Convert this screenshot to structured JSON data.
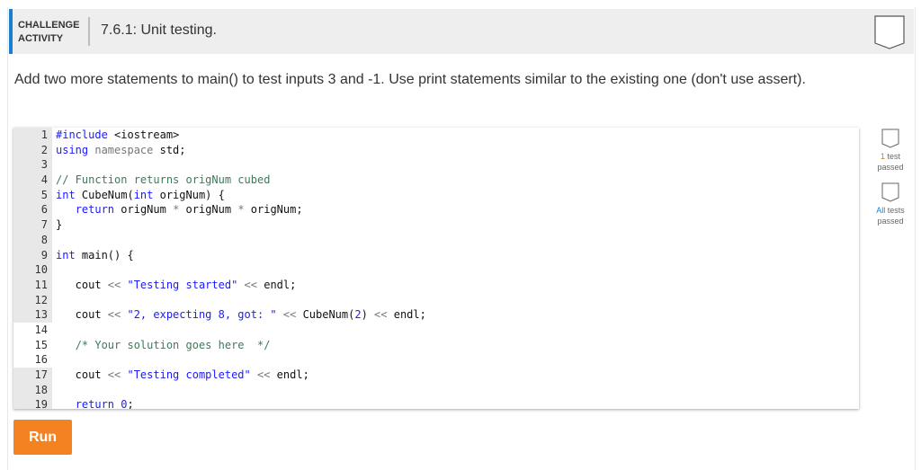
{
  "header": {
    "label_line1": "CHALLENGE",
    "label_line2": "ACTIVITY",
    "title": "7.6.1: Unit testing."
  },
  "instructions": "Add two more statements to main() to test inputs 3 and -1. Use print statements similar to the existing one (don't use assert).",
  "code_lines": [
    {
      "n": "1",
      "tokens": [
        [
          "kw",
          "#include "
        ],
        [
          "",
          "<iostream>"
        ]
      ]
    },
    {
      "n": "2",
      "tokens": [
        [
          "kw",
          "using "
        ],
        [
          "ns",
          "namespace "
        ],
        [
          "",
          "std;"
        ]
      ]
    },
    {
      "n": "3",
      "tokens": []
    },
    {
      "n": "4",
      "tokens": [
        [
          "cm",
          "// Function returns origNum cubed"
        ]
      ]
    },
    {
      "n": "5",
      "tokens": [
        [
          "kw",
          "int "
        ],
        [
          "",
          "CubeNum("
        ],
        [
          "kw",
          "int "
        ],
        [
          "",
          "origNum) {"
        ]
      ]
    },
    {
      "n": "6",
      "tokens": [
        [
          "",
          "   "
        ],
        [
          "kw",
          "return "
        ],
        [
          "",
          "origNum "
        ],
        [
          "op",
          "* "
        ],
        [
          "",
          "origNum "
        ],
        [
          "op",
          "* "
        ],
        [
          "",
          "origNum;"
        ]
      ]
    },
    {
      "n": "7",
      "tokens": [
        [
          "",
          "}"
        ]
      ]
    },
    {
      "n": "8",
      "tokens": []
    },
    {
      "n": "9",
      "tokens": [
        [
          "kw",
          "int "
        ],
        [
          "",
          "main() {"
        ]
      ]
    },
    {
      "n": "10",
      "tokens": []
    },
    {
      "n": "11",
      "tokens": [
        [
          "",
          "   cout "
        ],
        [
          "op",
          "<< "
        ],
        [
          "str",
          "\"Testing started\" "
        ],
        [
          "op",
          "<< "
        ],
        [
          "",
          "endl;"
        ]
      ]
    },
    {
      "n": "12",
      "tokens": []
    },
    {
      "n": "13",
      "tokens": [
        [
          "",
          "   cout "
        ],
        [
          "op",
          "<< "
        ],
        [
          "str",
          "\"2, expecting 8, got: \" "
        ],
        [
          "op",
          "<< "
        ],
        [
          "",
          "CubeNum("
        ],
        [
          "num",
          "2"
        ],
        [
          "",
          ") "
        ],
        [
          "op",
          "<< "
        ],
        [
          "",
          "endl;"
        ]
      ]
    },
    {
      "n": "14",
      "editable": true,
      "tokens": []
    },
    {
      "n": "15",
      "editable": true,
      "tokens": [
        [
          "",
          "   "
        ],
        [
          "cm",
          "/* Your solution goes here  */"
        ]
      ]
    },
    {
      "n": "16",
      "editable": true,
      "tokens": []
    },
    {
      "n": "17",
      "tokens": [
        [
          "",
          "   cout "
        ],
        [
          "op",
          "<< "
        ],
        [
          "str",
          "\"Testing completed\" "
        ],
        [
          "op",
          "<< "
        ],
        [
          "",
          "endl;"
        ]
      ]
    },
    {
      "n": "18",
      "tokens": []
    },
    {
      "n": "19",
      "tokens": [
        [
          "",
          "   "
        ],
        [
          "kw",
          "return "
        ],
        [
          "num",
          "0"
        ],
        [
          "",
          ";"
        ]
      ]
    }
  ],
  "run_label": "Run",
  "tests": [
    {
      "highlight": "1",
      "rest": " test",
      "line2": "passed"
    },
    {
      "highlight": "All",
      "rest": " tests",
      "line2": "passed"
    }
  ]
}
